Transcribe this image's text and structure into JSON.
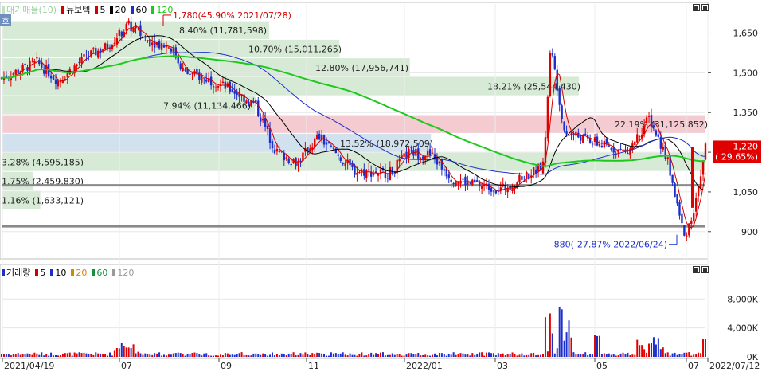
{
  "price_legend": {
    "first": "대기매물(10)",
    "items": [
      {
        "label": "뉴보텍",
        "color": "#d00000"
      },
      {
        "label": "5",
        "color": "#d00000"
      },
      {
        "label": "20",
        "color": "#000000"
      },
      {
        "label": "60",
        "color": "#1c2fcc"
      },
      {
        "label": "120",
        "color": "#1ec81e"
      }
    ]
  },
  "side_tab": "호",
  "volume_legend": {
    "items": [
      {
        "label": "거래량",
        "color": "#1c2fcc"
      },
      {
        "label": "5",
        "color": "#d00000"
      },
      {
        "label": "10",
        "color": "#1c2fcc"
      },
      {
        "label": "20",
        "color": "#d08a00"
      },
      {
        "label": "60",
        "color": "#108f3e"
      },
      {
        "label": "120",
        "color": "#999999"
      }
    ]
  },
  "chart_data": {
    "type": "candlestick",
    "price_axis_ticks": [
      "1,650",
      "1,500",
      "1,350",
      "1,200",
      "1,050",
      "900"
    ],
    "price_axis_values": [
      1650,
      1500,
      1350,
      1200,
      1050,
      900
    ],
    "price_ylim": [
      800,
      1760
    ],
    "volume_axis_ticks": [
      "8,000K",
      "4,000K",
      "0K"
    ],
    "volume_axis_values": [
      8000,
      4000,
      0
    ],
    "volume_ylim": [
      0,
      11000
    ],
    "x_tick_labels": [
      "2021/04/19",
      "07",
      "09",
      "11",
      "2022/01",
      "03",
      "05",
      "07",
      "2022/07/12"
    ],
    "supply_zones": [
      {
        "label": "8.40% (11,781,598)",
        "low": 1625,
        "high": 1695,
        "color": "#cfe6cf"
      },
      {
        "label": "10.70% (15,011,265)",
        "low": 1555,
        "high": 1625,
        "color": "#cfe6cf"
      },
      {
        "label": "12.80% (17,956,741)",
        "low": 1485,
        "high": 1555,
        "color": "#cfe6cf"
      },
      {
        "label": "18.21% (25,544,430)",
        "low": 1412,
        "high": 1485,
        "color": "#cfe6cf"
      },
      {
        "label": "7.94% (11,134,466)",
        "low": 1340,
        "high": 1412,
        "color": "#cfe6cf"
      },
      {
        "label": "22.19% (31,125,852)",
        "low": 1270,
        "high": 1340,
        "color": "#f1c2c9"
      },
      {
        "label": "13.52% (18,972,509)",
        "low": 1198,
        "high": 1270,
        "color": "#c9dceb"
      },
      {
        "label": "3.28% (4,595,185)",
        "low": 1126,
        "high": 1198,
        "color": "#cfe6cf"
      },
      {
        "label": "1.75% (2,459,830)",
        "low": 1054,
        "high": 1126,
        "color": "#cfe6cf"
      },
      {
        "label": "1.16% (1,633,121)",
        "low": 983,
        "high": 1054,
        "color": "#cfe6cf"
      }
    ],
    "horizontal_lines": [
      1075,
      920
    ],
    "annotations": {
      "high": "1,780(45.90% 2021/07/28)",
      "low": "880(-27.87% 2022/06/24)"
    },
    "current_price": "1,220",
    "current_change": "( 29.65%)",
    "series": [
      {
        "name": "5",
        "color": "#d00000"
      },
      {
        "name": "20",
        "color": "#000000"
      },
      {
        "name": "60",
        "color": "#1c2fcc"
      },
      {
        "name": "120",
        "color": "#1ec81e"
      }
    ],
    "key_closes": [
      {
        "t": 0,
        "c": 1480
      },
      {
        "t": 0.05,
        "c": 1540
      },
      {
        "t": 0.08,
        "c": 1470
      },
      {
        "t": 0.12,
        "c": 1560
      },
      {
        "t": 0.15,
        "c": 1600
      },
      {
        "t": 0.18,
        "c": 1680
      },
      {
        "t": 0.21,
        "c": 1620
      },
      {
        "t": 0.24,
        "c": 1600
      },
      {
        "t": 0.26,
        "c": 1500
      },
      {
        "t": 0.3,
        "c": 1470
      },
      {
        "t": 0.33,
        "c": 1430
      },
      {
        "t": 0.36,
        "c": 1380
      },
      {
        "t": 0.39,
        "c": 1200
      },
      {
        "t": 0.42,
        "c": 1160
      },
      {
        "t": 0.45,
        "c": 1260
      },
      {
        "t": 0.5,
        "c": 1130
      },
      {
        "t": 0.55,
        "c": 1120
      },
      {
        "t": 0.58,
        "c": 1200
      },
      {
        "t": 0.61,
        "c": 1190
      },
      {
        "t": 0.64,
        "c": 1100
      },
      {
        "t": 0.67,
        "c": 1080
      },
      {
        "t": 0.71,
        "c": 1060
      },
      {
        "t": 0.74,
        "c": 1100
      },
      {
        "t": 0.77,
        "c": 1150
      },
      {
        "t": 0.78,
        "c": 1600
      },
      {
        "t": 0.8,
        "c": 1280
      },
      {
        "t": 0.83,
        "c": 1250
      },
      {
        "t": 0.86,
        "c": 1220
      },
      {
        "t": 0.89,
        "c": 1200
      },
      {
        "t": 0.92,
        "c": 1330
      },
      {
        "t": 0.945,
        "c": 1180
      },
      {
        "t": 0.97,
        "c": 880
      },
      {
        "t": 0.985,
        "c": 990
      },
      {
        "t": 1.0,
        "c": 1220
      }
    ]
  }
}
